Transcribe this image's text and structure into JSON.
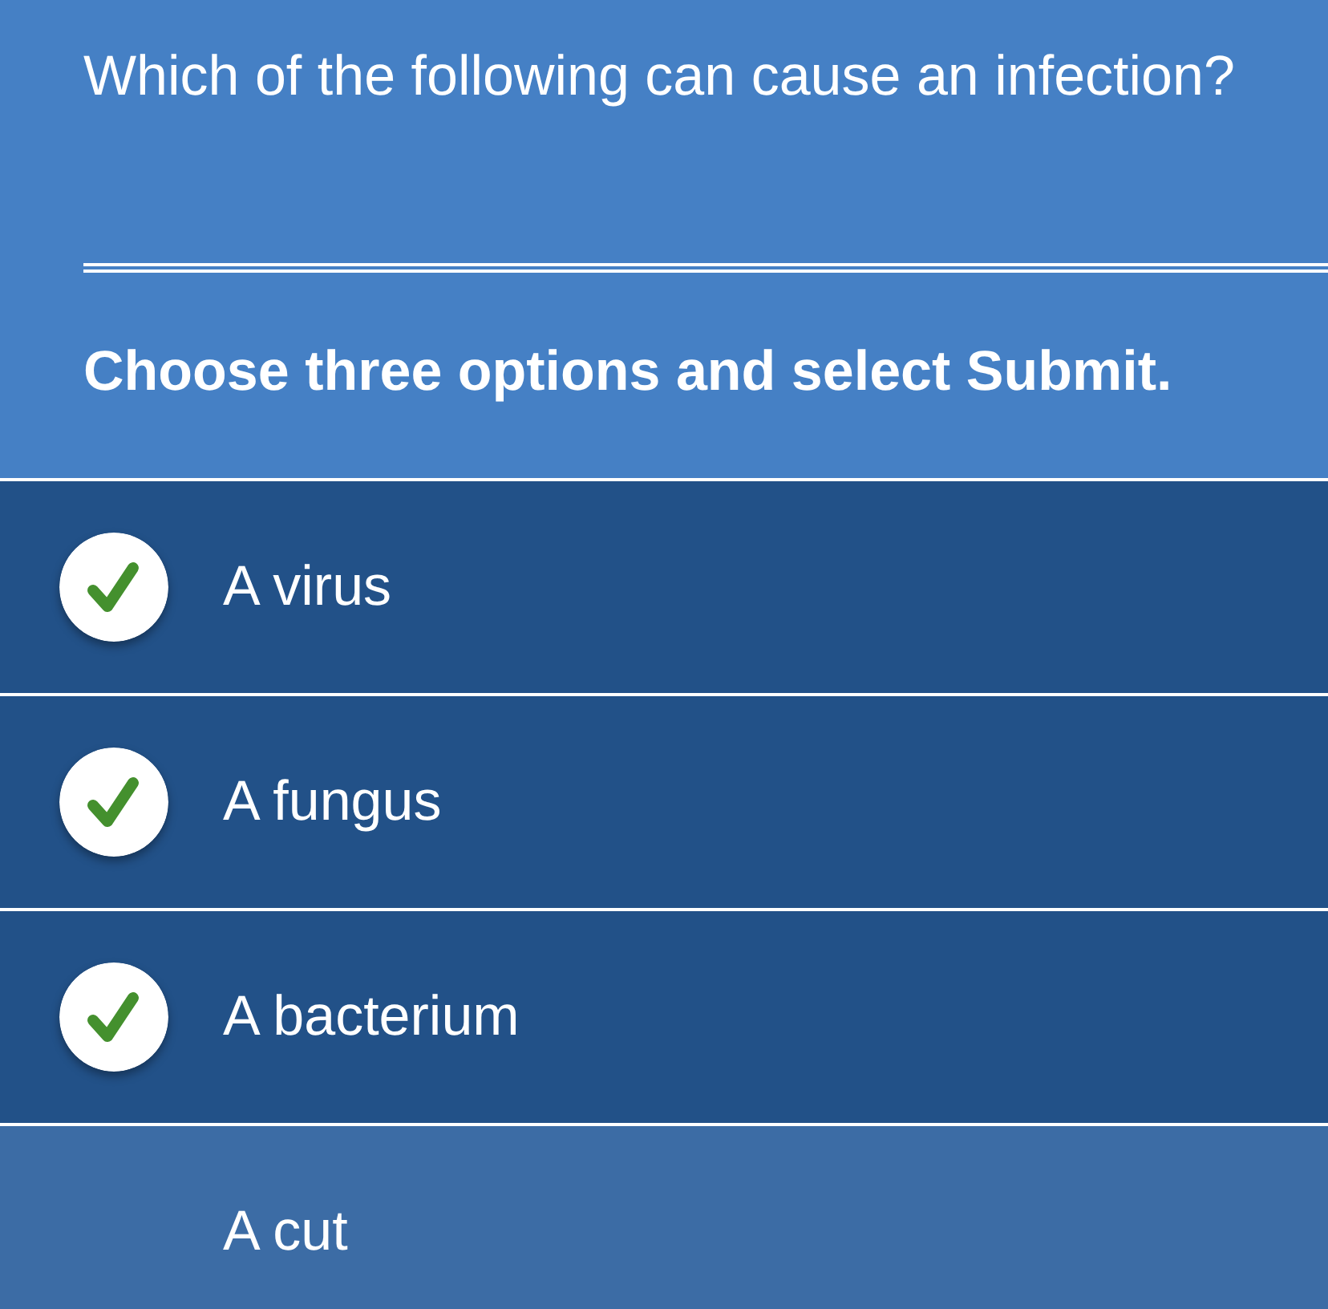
{
  "question": {
    "text": "Which of the following can cause an infection?",
    "instruction": "Choose three options and select Submit."
  },
  "options": [
    {
      "label": "A virus",
      "selected": true
    },
    {
      "label": "A fungus",
      "selected": true
    },
    {
      "label": "A bacterium",
      "selected": true
    },
    {
      "label": "A cut",
      "selected": false
    }
  ]
}
